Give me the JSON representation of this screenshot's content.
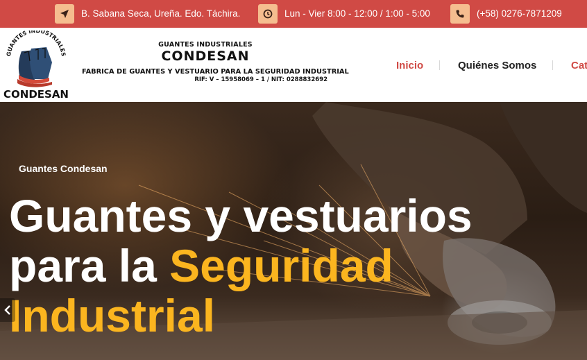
{
  "topbar": {
    "address": {
      "icon": "location-arrow-icon",
      "text": "B. Sabana Seca, Ureña. Edo. Táchira."
    },
    "hours": {
      "icon": "clock-icon",
      "text": "Lun - Vier 8:00 - 12:00 / 1:00 - 5:00"
    },
    "phone": {
      "icon": "phone-icon",
      "text": "(+58) 0276-7871209"
    }
  },
  "header": {
    "logo_text_top": "GUANTES INDUSTRIALES",
    "logo_text_bottom": "CONDESAN",
    "brand_small": "GUANTES INDUSTRIALES",
    "brand_big": "CONDESAN",
    "brand_sub": "FABRICA DE GUANTES Y VESTUARIO PARA LA SEGURIDAD INDUSTRIAL",
    "brand_rif": "RIF: V – 15958069 – 1 /  NIT: 0288832692"
  },
  "nav": {
    "items": [
      {
        "label": "Inicio",
        "active": true
      },
      {
        "label": "Quiénes Somos",
        "active": false
      },
      {
        "label": "Cat",
        "active": false
      }
    ]
  },
  "hero": {
    "kicker": "Guantes Condesan",
    "title_line1": "Guantes y vestuarios",
    "title_line2_plain": "para la ",
    "title_line2_highlight": "Seguridad",
    "title_line3_highlight": "Industrial",
    "prev_icon": "chevron-left-icon"
  },
  "colors": {
    "topbar_bg": "#d04a45",
    "icon_bg": "#f5bd8f",
    "accent_red": "#d04a45",
    "highlight_yellow": "#fbb51f"
  }
}
